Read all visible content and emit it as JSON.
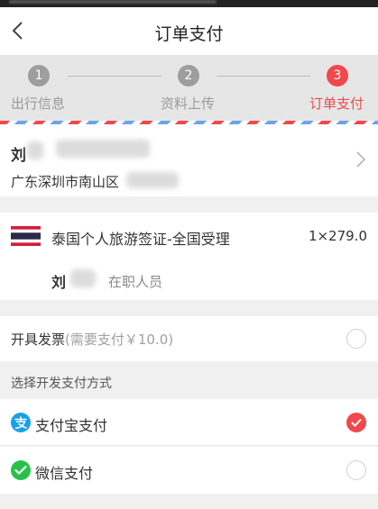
{
  "header": {
    "title": "订单支付",
    "back_icon": "chevron-left-icon"
  },
  "steps": [
    {
      "number": "1",
      "label": "出行信息",
      "active": false
    },
    {
      "number": "2",
      "label": "资料上传",
      "active": false
    },
    {
      "number": "3",
      "label": "订单支付",
      "active": true
    }
  ],
  "address": {
    "name": "刘",
    "line": "广东深圳市南山区",
    "chevron_icon": "chevron-right-icon"
  },
  "product": {
    "flag_icon": "thailand-flag-icon",
    "name": "泰国个人旅游签证-全国受理",
    "quantity_price": "1×279.0",
    "traveler_name": "刘",
    "traveler_role": "在职人员"
  },
  "invoice": {
    "label": "开具发票",
    "note": "(需要支付￥10.0)",
    "checked": false
  },
  "payment": {
    "section_title": "选择开发支付方式",
    "methods": [
      {
        "label": "支付宝支付",
        "icon": "alipay-icon",
        "selected": true
      },
      {
        "label": "微信支付",
        "icon": "wechat-pay-icon",
        "selected": false
      }
    ]
  },
  "colors": {
    "accent": "#f0484c",
    "alipay": "#1aa0e8",
    "wechat": "#27c14a",
    "inactive_step": "#9e9e9e"
  }
}
